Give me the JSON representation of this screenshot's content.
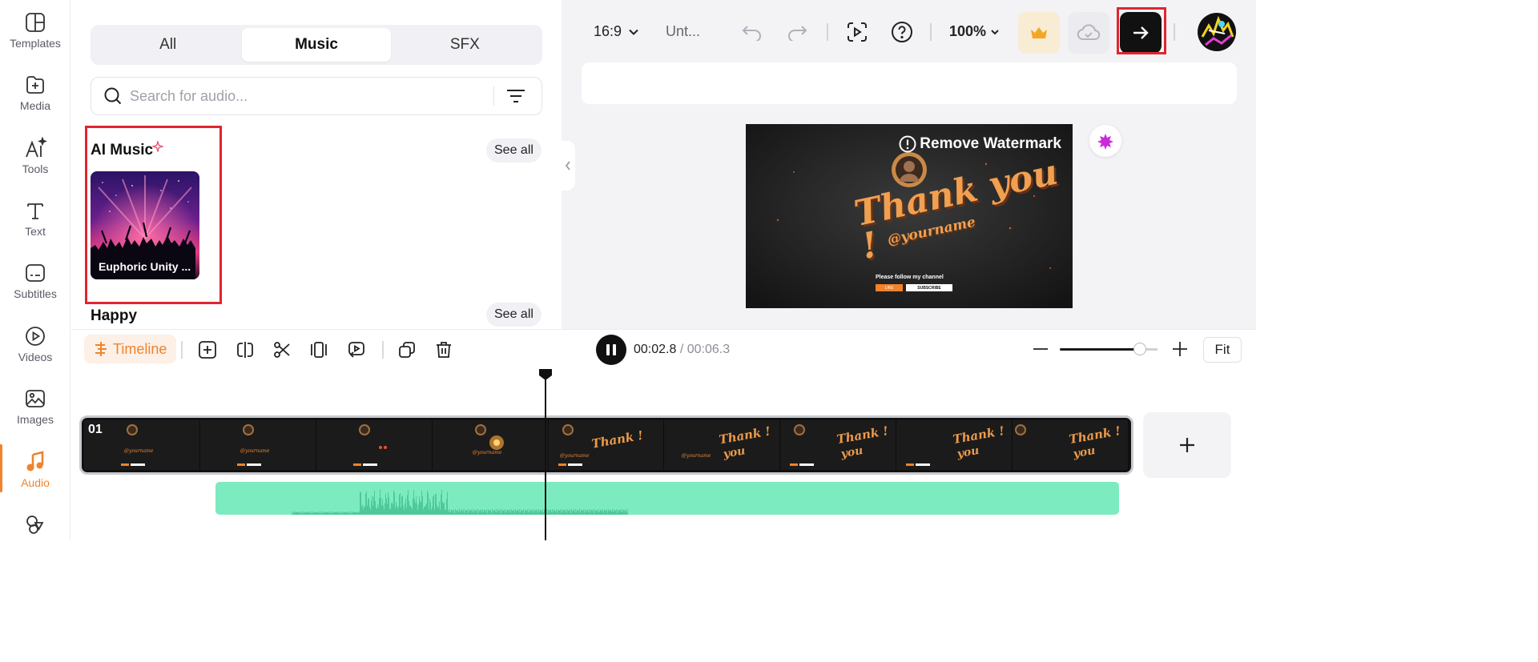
{
  "sidebar": {
    "items": [
      {
        "label": "Templates",
        "icon": "templates-icon",
        "active": false
      },
      {
        "label": "Media",
        "icon": "media-icon",
        "active": false
      },
      {
        "label": "Tools",
        "icon": "ai-tools-icon",
        "active": false
      },
      {
        "label": "Text",
        "icon": "text-icon",
        "active": false
      },
      {
        "label": "Subtitles",
        "icon": "subtitles-icon",
        "active": false
      },
      {
        "label": "Videos",
        "icon": "videos-icon",
        "active": false
      },
      {
        "label": "Images",
        "icon": "images-icon",
        "active": false
      },
      {
        "label": "Audio",
        "icon": "music-note-icon",
        "active": true
      },
      {
        "label": "",
        "icon": "shapes-icon",
        "active": false
      }
    ],
    "accent": "#f0832b"
  },
  "audio_panel": {
    "tabs": [
      {
        "label": "All",
        "selected": false
      },
      {
        "label": "Music",
        "selected": true
      },
      {
        "label": "SFX",
        "selected": false
      }
    ],
    "search": {
      "placeholder": "Search for audio...",
      "value": ""
    },
    "sections": [
      {
        "title": "AI Music",
        "see_all": "See all",
        "cards": [
          {
            "label": "Euphoric Unity ..."
          }
        ]
      },
      {
        "title": "Happy",
        "see_all": "See all",
        "cards": []
      }
    ]
  },
  "topbar": {
    "aspect_ratio": "16:9",
    "project_name": "Unt...",
    "zoom": "100%",
    "export_color": "#111111",
    "premium_color": "#f8ecd4"
  },
  "preview": {
    "watermark_text": "Remove Watermark",
    "video_title": "Thank you !",
    "video_handle": "@yourname",
    "video_caption": "Please follow my channel",
    "like_label": "LIKE",
    "subscribe_label": "SUBSCRIBE"
  },
  "timeline": {
    "label": "Timeline",
    "current_time": "00:02.8",
    "duration": "/ 00:06.3",
    "fit_label": "Fit",
    "zoom_level": 0.82,
    "track_number": "01",
    "audio_color": "#7debc0"
  }
}
